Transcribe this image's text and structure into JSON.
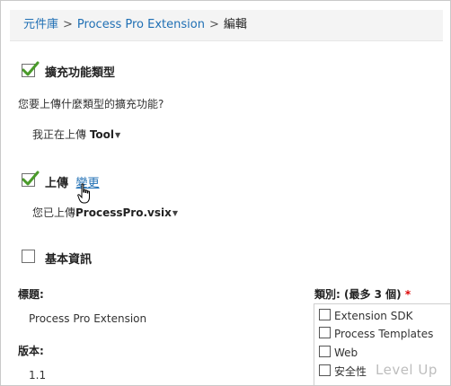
{
  "breadcrumb": {
    "root": "元件庫",
    "separator": ">",
    "item": "Process Pro Extension",
    "current": "編輯"
  },
  "extension_type": {
    "title": "擴充功能類型",
    "checked": true,
    "question": "您要上傳什麼類型的擴充功能?",
    "uploading_prefix": "我正在上傳",
    "uploading_value": "Tool"
  },
  "upload": {
    "title": "上傳",
    "checked": true,
    "change_link": "變更",
    "uploaded_prefix": "您已上傳",
    "uploaded_file": "ProcessPro.vsix"
  },
  "basic_info": {
    "title": "基本資訊",
    "checked": false,
    "title_label": "標題:",
    "title_value": "Process Pro Extension",
    "version_label": "版本:",
    "version_value": "1.1",
    "categories_label": "類別: (最多 3 個)",
    "required_mark": "*",
    "categories": [
      {
        "label": "Extension SDK",
        "checked": false
      },
      {
        "label": "Process Templates",
        "checked": false
      },
      {
        "label": "Web",
        "checked": false
      },
      {
        "label": "安全性",
        "checked": false
      }
    ]
  },
  "watermark": "Level Up",
  "icons": {
    "check": "green-check-icon",
    "cursor": "hand-pointer-icon",
    "chevron": "chevron-down-icon"
  },
  "colors": {
    "link": "#1f6fb4",
    "check": "#4a9a2a",
    "required": "#dd0000",
    "breadcrumb_bg": "#f4f4f4",
    "watermark": "#bdbdbd"
  }
}
